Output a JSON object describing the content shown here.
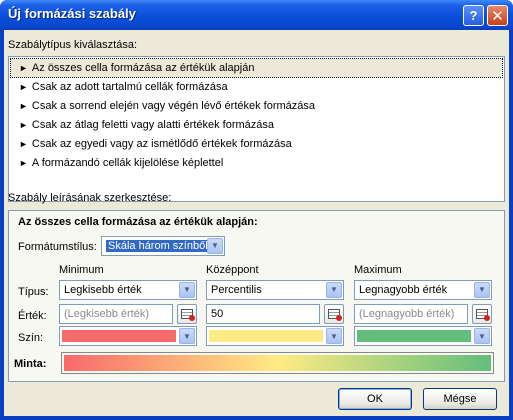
{
  "window": {
    "title": "Új formázási szabály",
    "help_label": "?",
    "close_label": "✕"
  },
  "rule_type": {
    "label": "Szabálytípus kiválasztása:",
    "items": [
      "Az összes cella formázása az értékük alapján",
      "Csak az adott tartalmú cellák formázása",
      "Csak a sorrend elején vagy végén lévő értékek formázása",
      "Csak az átlag feletti vagy alatti értékek formázása",
      "Csak az egyedi vagy az ismétlődő értékek formázása",
      "A formázandó cellák kijelölése képlettel"
    ],
    "arrow": "►"
  },
  "description": {
    "label": "Szabály leírásának szerkesztése:",
    "heading": "Az összes cella formázása az értékük alapján:",
    "style_label": "Formátumstílus:",
    "style_value": "Skála három színből",
    "columns": {
      "min": "Minimum",
      "mid": "Középpont",
      "max": "Maximum"
    },
    "row_labels": {
      "type": "Típus:",
      "value": "Érték:",
      "color": "Szín:"
    },
    "type_values": {
      "min": "Legkisebb érték",
      "mid": "Percentilis",
      "max": "Legnagyobb érték"
    },
    "value_values": {
      "min": "(Legkisebb érték)",
      "mid": "50",
      "max": "(Legnagyobb érték)"
    },
    "colors": {
      "min": "#f8696b",
      "mid": "#ffeb84",
      "max": "#63be7b"
    },
    "preview_label": "Minta:"
  },
  "buttons": {
    "ok": "OK",
    "cancel": "Mégse"
  },
  "icons": {
    "dropdown": "▼"
  }
}
